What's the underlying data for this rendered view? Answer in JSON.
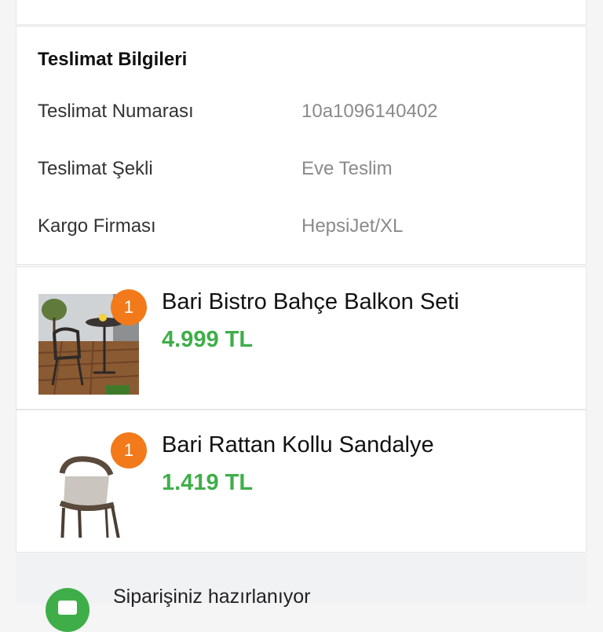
{
  "delivery_info": {
    "title": "Teslimat Bilgileri",
    "rows": [
      {
        "label": "Teslimat Numarası",
        "value": "10a1096140402"
      },
      {
        "label": "Teslimat Şekli",
        "value": "Eve Teslim"
      },
      {
        "label": "Kargo Firması",
        "value": "HepsiJet/XL"
      }
    ]
  },
  "products": [
    {
      "name": "Bari Bistro Bahçe Balkon Seti",
      "price": "4.999 TL",
      "quantity": "1",
      "image": "bistro-set-photo"
    },
    {
      "name": "Bari Rattan Kollu Sandalye",
      "price": "1.419 TL",
      "quantity": "1",
      "image": "rattan-chair-photo"
    }
  ],
  "status": {
    "text": "Siparişiniz hazırlanıyor",
    "icon": "status-check-icon"
  },
  "colors": {
    "price_green": "#3fae49",
    "badge_orange": "#f27a1a"
  }
}
